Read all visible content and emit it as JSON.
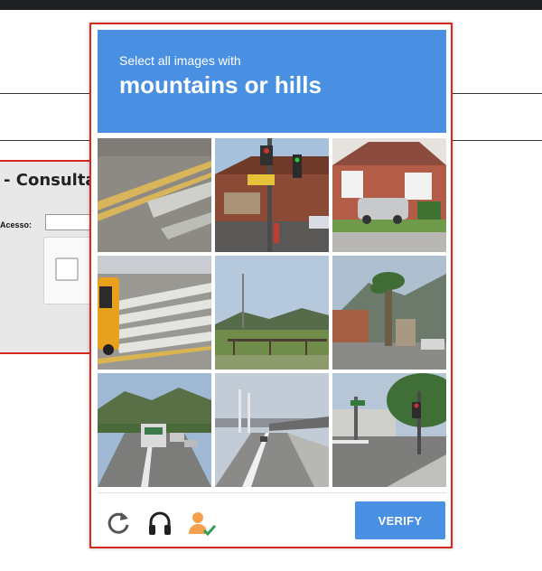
{
  "background_page": {
    "title": "- Consulta",
    "field_label": "Acesso:"
  },
  "challenge": {
    "instruction": "Select all images with",
    "target": "mountains or hills",
    "tiles": [
      {
        "scene": "road-crosswalk-closeup"
      },
      {
        "scene": "street-sign-traffic-light"
      },
      {
        "scene": "house-with-suv"
      },
      {
        "scene": "crosswalk-with-bus"
      },
      {
        "scene": "hills-with-bridge"
      },
      {
        "scene": "mountain-palm-tree"
      },
      {
        "scene": "highway-with-hills"
      },
      {
        "scene": "bridge-highway"
      },
      {
        "scene": "intersection-traffic-light"
      }
    ],
    "footer": {
      "reload_icon": "reload-icon",
      "audio_icon": "headphones-icon",
      "info_icon": "person-check-icon",
      "verify_label": "VERIFY"
    }
  },
  "colors": {
    "accent": "#4a90e2",
    "frame_border": "#d52b1e"
  }
}
